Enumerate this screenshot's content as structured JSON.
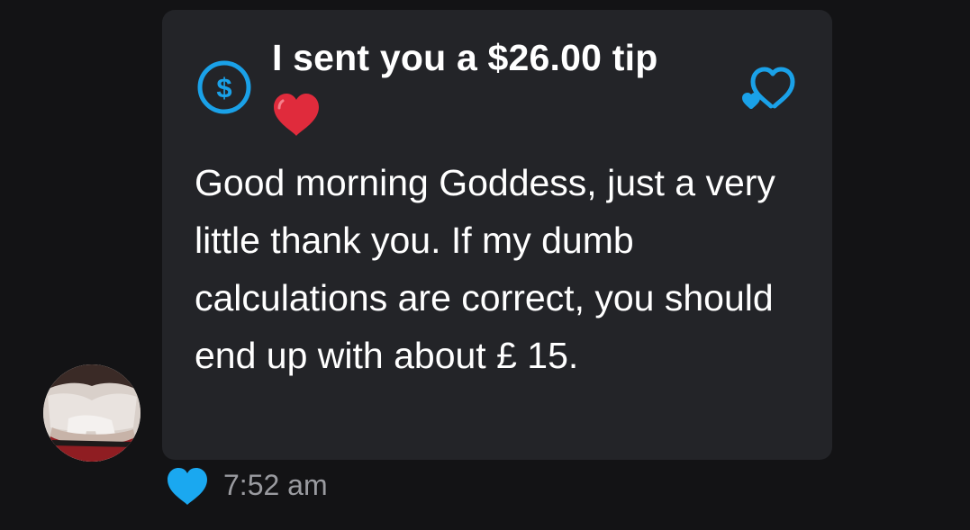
{
  "message": {
    "tip_title": "I sent you a $26.00 tip",
    "text": "Good morning Goddess, just a very little thank you. If my dumb calculations are correct, you should end up with about £ 15.",
    "timestamp": "7:52 am"
  },
  "icons": {
    "tip": "dollar-circle-icon",
    "emoji": "red-heart-icon",
    "action": "heart-link-icon",
    "like": "heart-like-icon"
  },
  "colors": {
    "background": "#131315",
    "bubble": "#232428",
    "accent": "#1aa1e8",
    "like": "#1aa8f0",
    "heart_emoji": "#e02b3c",
    "timestamp": "#9a9ba0",
    "text": "#ffffff"
  }
}
